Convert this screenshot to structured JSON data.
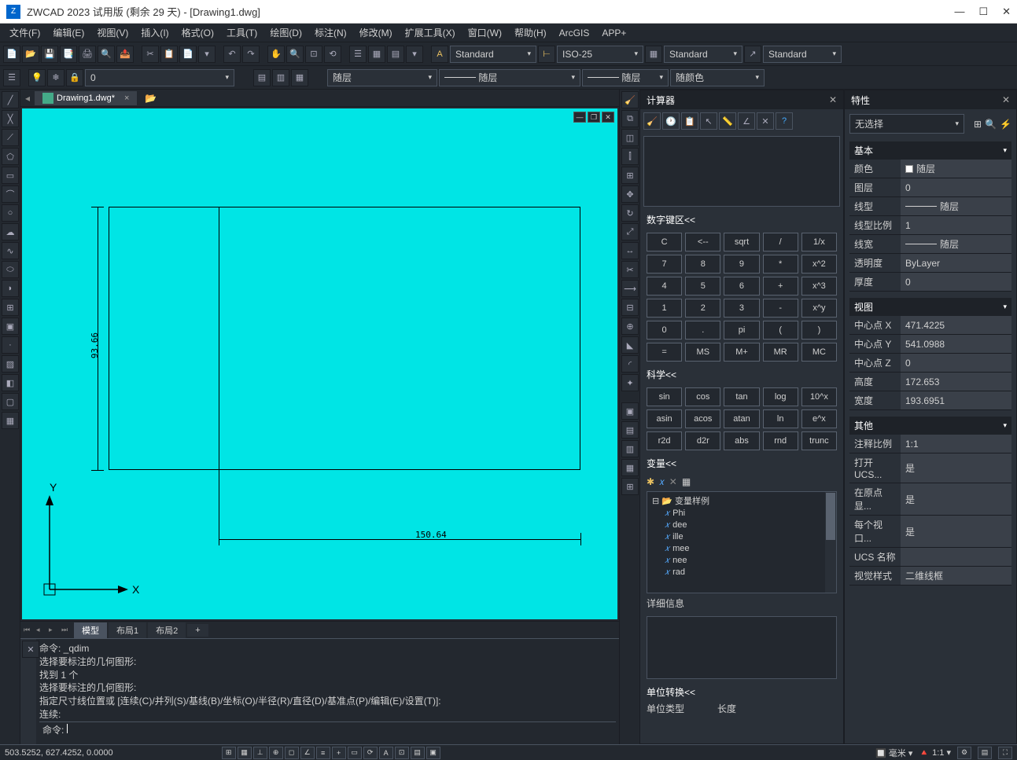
{
  "title": "ZWCAD 2023 试用版 (剩余 29 天) - [Drawing1.dwg]",
  "menubar": [
    "文件(F)",
    "编辑(E)",
    "视图(V)",
    "插入(I)",
    "格式(O)",
    "工具(T)",
    "绘图(D)",
    "标注(N)",
    "修改(M)",
    "扩展工具(X)",
    "窗口(W)",
    "帮助(H)",
    "ArcGIS",
    "APP+"
  ],
  "toolbar1": {
    "style1": "Standard",
    "style2": "ISO-25",
    "style3": "Standard",
    "style4": "Standard"
  },
  "toolbar2": {
    "layer_combo": "0",
    "lt1": "随层",
    "lt2": "随层",
    "lw": "随层",
    "color": "随颜色"
  },
  "doctab": {
    "name": "Drawing1.dwg*"
  },
  "drawing": {
    "dim_v": "93.66",
    "dim_h": "150.64",
    "ucs_y": "Y",
    "ucs_x": "X"
  },
  "layout_tabs": {
    "model": "模型",
    "l1": "布局1",
    "l2": "布局2",
    "add": "+"
  },
  "cmdline": {
    "l1": "命令: _qdim",
    "l2": "选择要标注的几何图形:",
    "l3": "找到 1 个",
    "l4": "选择要标注的几何图形:",
    "l5": "指定尺寸线位置或 [连续(C)/并列(S)/基线(B)/坐标(O)/半径(R)/直径(D)/基准点(P)/编辑(E)/设置(T)]:",
    "l6": "连续:",
    "prompt": "命令: "
  },
  "calc": {
    "title": "计算器",
    "numpad_hdr": "数字键区<<",
    "keys": [
      "C",
      "<--",
      "sqrt",
      "/",
      "1/x",
      "7",
      "8",
      "9",
      "*",
      "x^2",
      "4",
      "5",
      "6",
      "+",
      "x^3",
      "1",
      "2",
      "3",
      "-",
      "x^y",
      "0",
      ".",
      "pi",
      "(",
      ")",
      "=",
      "MS",
      "M+",
      "MR",
      "MC"
    ],
    "sci_hdr": "科学<<",
    "sci_keys": [
      "sin",
      "cos",
      "tan",
      "log",
      "10^x",
      "asin",
      "acos",
      "atan",
      "ln",
      "e^x",
      "r2d",
      "d2r",
      "abs",
      "rnd",
      "trunc"
    ],
    "var_hdr": "变量<<",
    "var_root": "变量样例",
    "vars": [
      "Phi",
      "dee",
      "ille",
      "mee",
      "nee",
      "rad"
    ],
    "detail_hdr": "详细信息",
    "unit_hdr": "单位转换<<",
    "unit_type": "单位类型",
    "unit_len": "长度"
  },
  "props": {
    "title": "特性",
    "sel": "无选择",
    "sec_basic": "基本",
    "basic": {
      "color_l": "颜色",
      "color_v": "随层",
      "layer_l": "图层",
      "layer_v": "0",
      "ltype_l": "线型",
      "ltype_v": "随层",
      "ltscale_l": "线型比例",
      "ltscale_v": "1",
      "lw_l": "线宽",
      "lw_v": "随层",
      "trans_l": "透明度",
      "trans_v": "ByLayer",
      "thick_l": "厚度",
      "thick_v": "0"
    },
    "sec_view": "视图",
    "view": {
      "cx_l": "中心点 X",
      "cx_v": "471.4225",
      "cy_l": "中心点 Y",
      "cy_v": "541.0988",
      "cz_l": "中心点 Z",
      "cz_v": "0",
      "h_l": "高度",
      "h_v": "172.653",
      "w_l": "宽度",
      "w_v": "193.6951"
    },
    "sec_other": "其他",
    "other": {
      "as_l": "注释比例",
      "as_v": "1:1",
      "ucs1_l": "打开 UCS...",
      "ucs1_v": "是",
      "ucs2_l": "在原点显...",
      "ucs2_v": "是",
      "ucs3_l": "每个视口...",
      "ucs3_v": "是",
      "ucsn_l": "UCS 名称",
      "ucsn_v": "",
      "vs_l": "视觉样式",
      "vs_v": "二维线框"
    }
  },
  "statusbar": {
    "coords": "503.5252, 627.4252, 0.0000",
    "unit": "毫米",
    "scale": "1:1"
  }
}
